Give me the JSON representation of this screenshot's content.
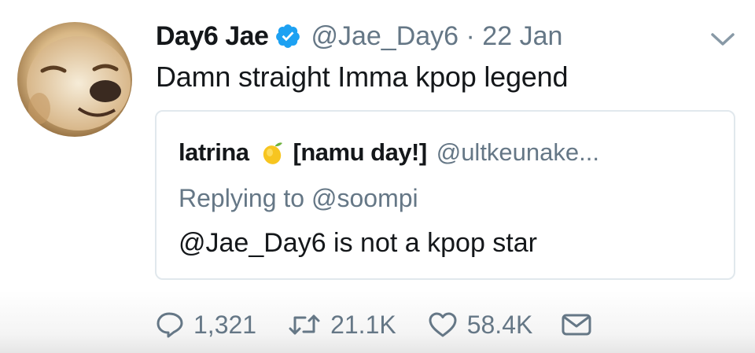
{
  "tweet": {
    "author_name": "Day6 Jae",
    "author_handle": "@Jae_Day6",
    "date": "22 Jan",
    "handle_and_date": "@Jae_Day6 · 22 Jan",
    "text": "Damn straight Imma kpop legend",
    "verified": true,
    "icons": {
      "verified": "verified-badge-icon",
      "menu": "chevron-down-icon"
    },
    "colors": {
      "accent": "#1da1f2",
      "secondary_text": "#657786"
    }
  },
  "quote": {
    "author_name": "latrina",
    "name_emoji": "lemon-emoji",
    "name_suffix": "[namu day!]",
    "author_handle": "@ultkeunake...",
    "replying_to": "Replying to @soompi",
    "text": "@Jae_Day6 is not a kpop star"
  },
  "actions": {
    "replies": "1,321",
    "retweets": "21.1K",
    "likes": "58.4K",
    "icons": [
      "reply-icon",
      "retweet-icon",
      "like-icon",
      "message-icon"
    ]
  }
}
